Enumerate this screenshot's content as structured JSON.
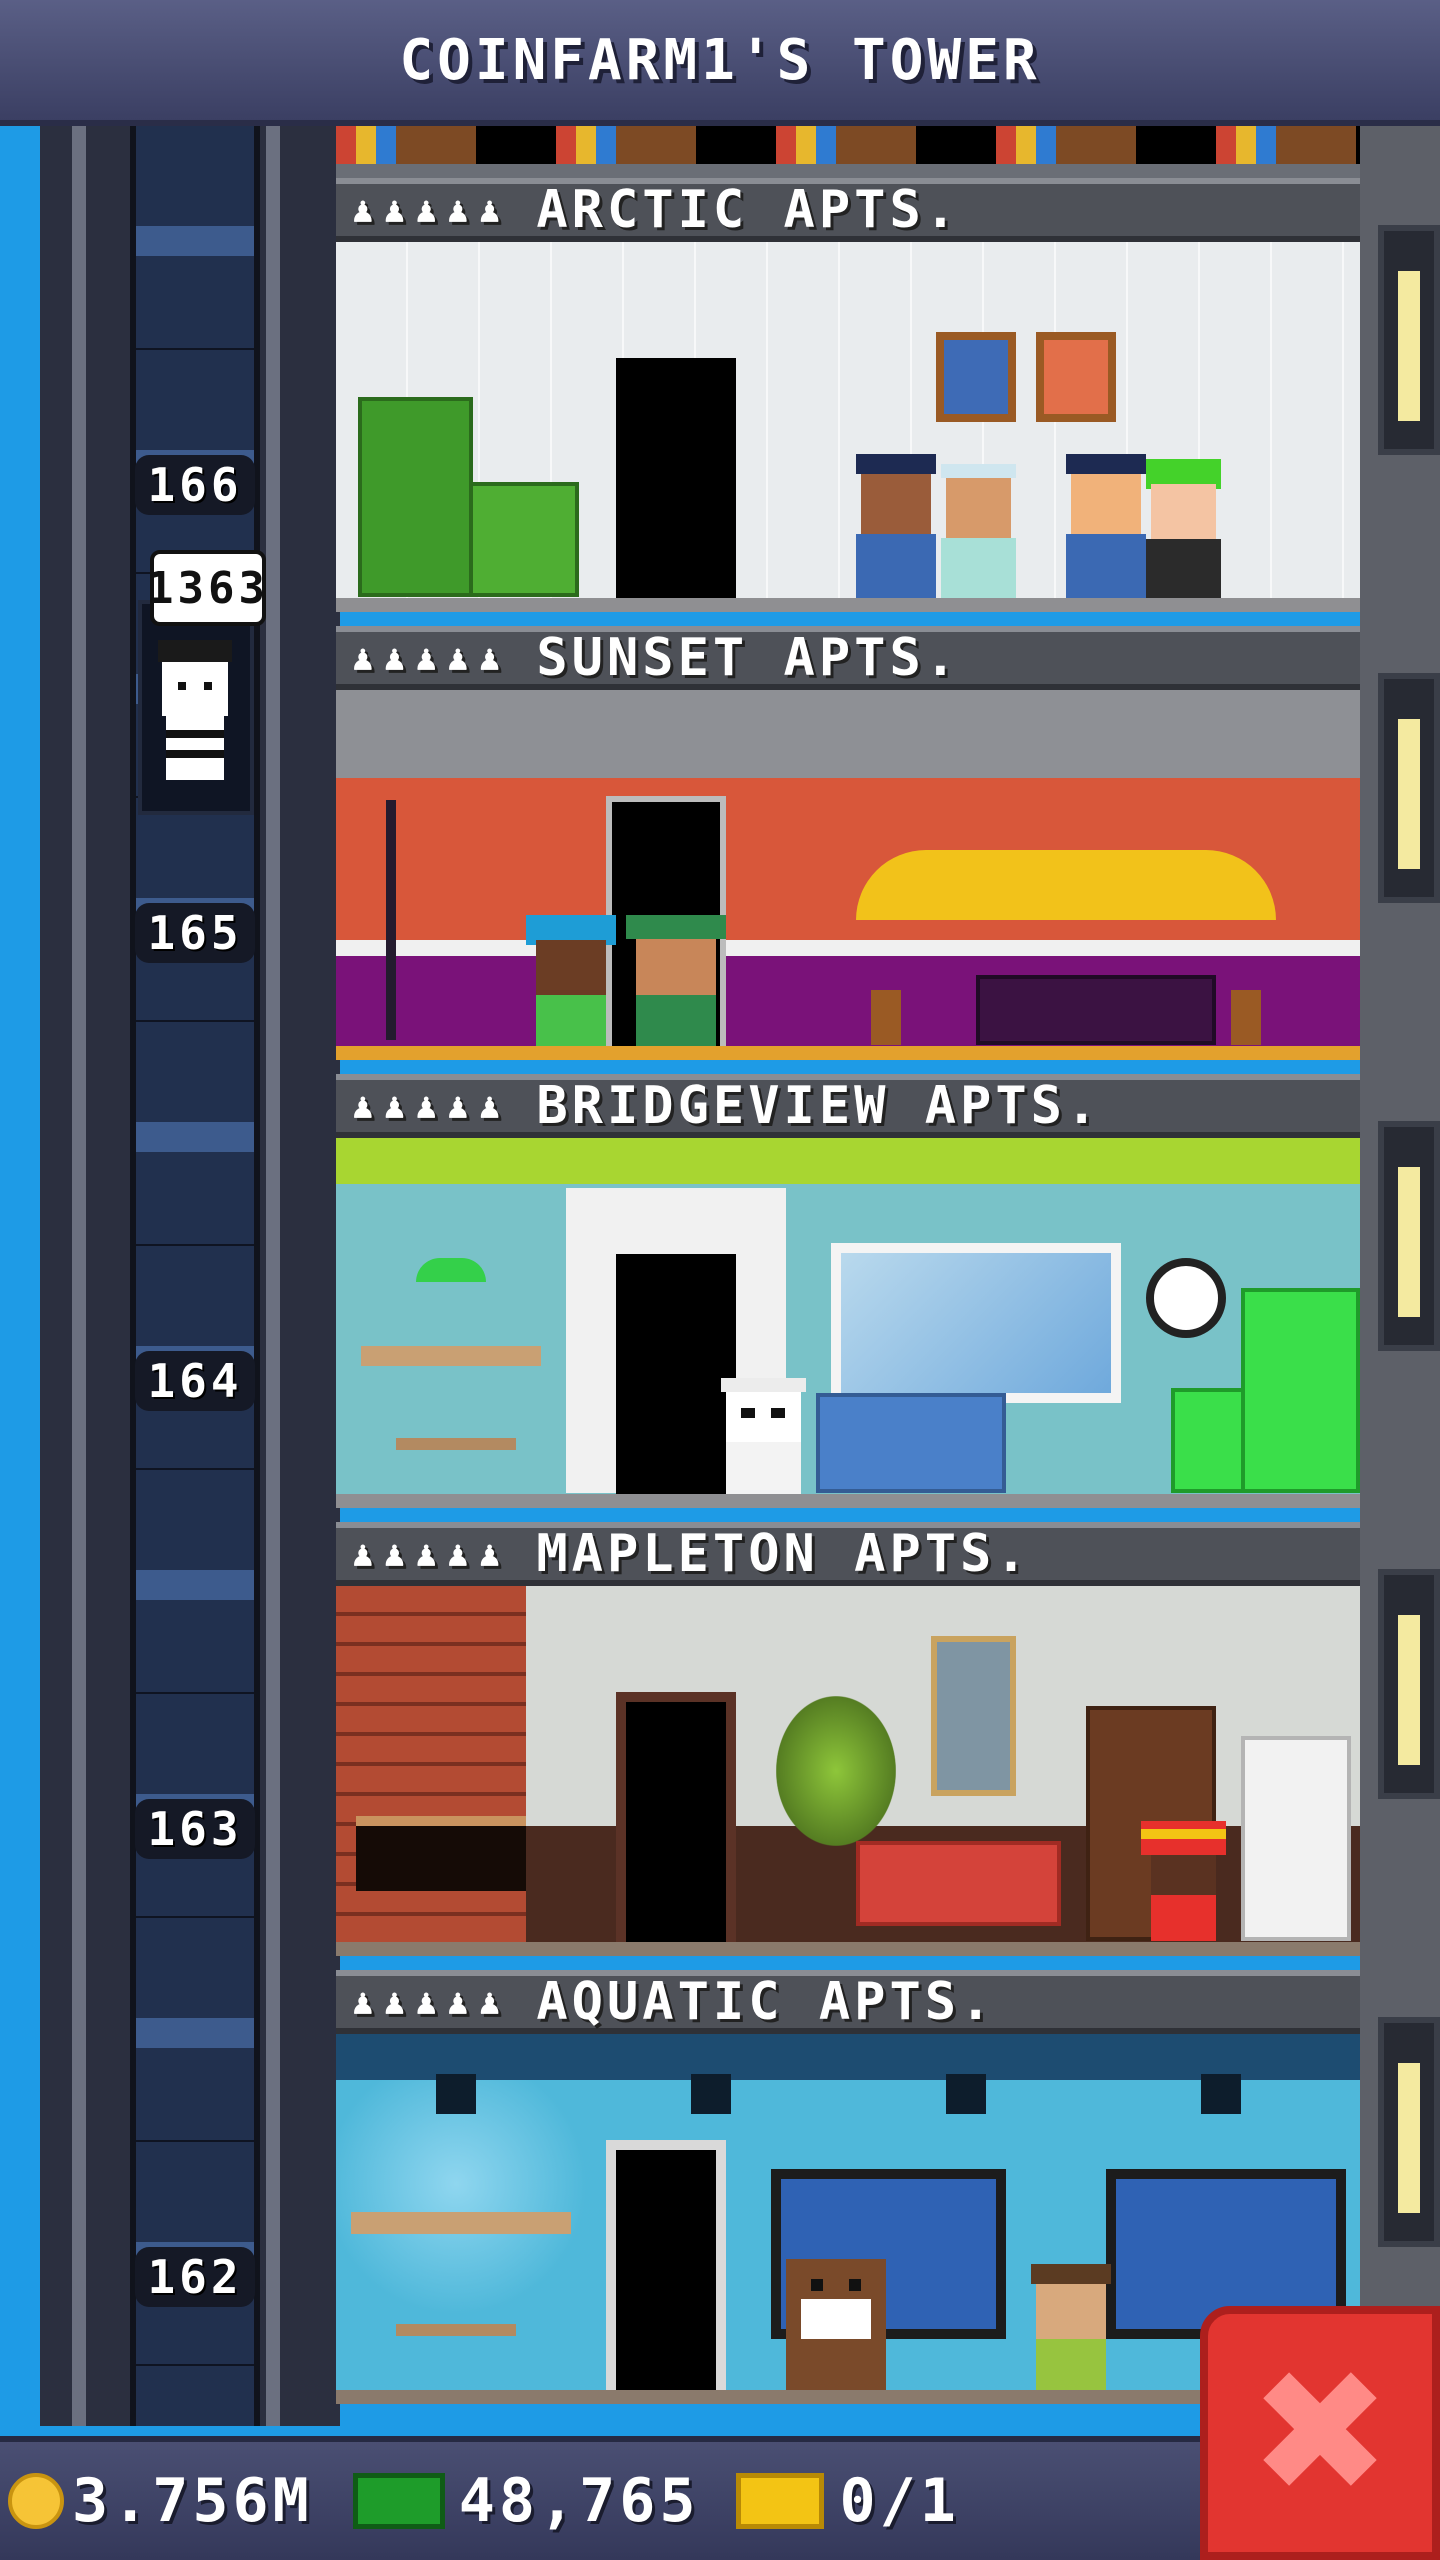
{
  "header": {
    "title": "COINFARM1'S TOWER"
  },
  "elevator": {
    "floor_labels": [
      "166",
      "165",
      "164",
      "163",
      "162"
    ],
    "passenger_bubble": "1363"
  },
  "floors": [
    {
      "name": "ARCTIC APTS.",
      "capacity": "♟♟♟♟♟",
      "theme": "arctic",
      "wall": "#eef1f3",
      "accent": "#3fa22a"
    },
    {
      "name": "SUNSET APTS.",
      "capacity": "♟♟♟♟♟",
      "theme": "sunset",
      "wall": "#d8573a",
      "accent": "#7a1279"
    },
    {
      "name": "BRIDGEVIEW APTS.",
      "capacity": "♟♟♟♟♟",
      "theme": "bridgeview",
      "wall": "#79c2c8",
      "accent": "#a8d631"
    },
    {
      "name": "MAPLETON APTS.",
      "capacity": "♟♟♟♟♟",
      "theme": "mapleton",
      "wall": "#d6d9d5",
      "accent": "#d4433a"
    },
    {
      "name": "AQUATIC APTS.",
      "capacity": "♟♟♟♟♟",
      "theme": "aquatic",
      "wall": "#4fb8da",
      "accent": "#1d4c71"
    }
  ],
  "footer": {
    "coins": "3.756M",
    "bux": "48,765",
    "tickets": "0/1",
    "coin_icon": "coin-icon",
    "bux_icon": "bux-icon",
    "ticket_icon": "ticket-icon",
    "close_glyph": "✖"
  }
}
